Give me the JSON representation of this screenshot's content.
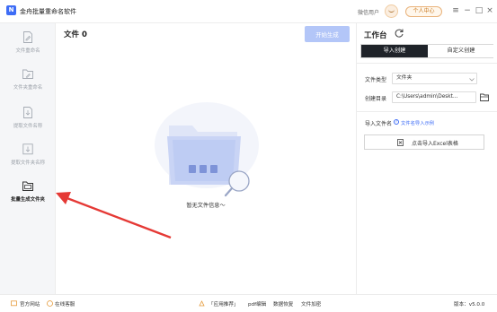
{
  "titlebar": {
    "app_title": "金舟批量重命名软件",
    "user_label": "微信用户",
    "vip_button": "个人中心",
    "menu_icon": "≡",
    "minimize_icon": "−",
    "maximize_icon": "□",
    "close_icon": "×"
  },
  "sidebar": {
    "items": [
      {
        "label": "文件重命名",
        "icon": "file-rename-icon"
      },
      {
        "label": "文件夹重命名",
        "icon": "folder-rename-icon"
      },
      {
        "label": "提取文件名称",
        "icon": "extract-file-icon"
      },
      {
        "label": "提取文件夹名称",
        "icon": "extract-folder-icon"
      },
      {
        "label": "批量生成文件夹",
        "icon": "batch-folder-icon",
        "active": true
      }
    ]
  },
  "main": {
    "file_count_title": "文件 0",
    "start_button": "开始生成",
    "empty_text": "暂无文件信息～"
  },
  "panel": {
    "title": "工作台",
    "tabs": [
      {
        "label": "导入创建",
        "active": true
      },
      {
        "label": "自定义创建",
        "active": false
      }
    ],
    "file_type_label": "文件类型",
    "file_type_value": "文件夹",
    "create_dir_label": "创建目录",
    "create_dir_value": "C:\\Users\\admin\\Deskt...",
    "import_names_label": "导入文件名",
    "help_link": "文件名导入示例",
    "import_button": "点击导入Excel表格"
  },
  "bottombar": {
    "official_site": "官方网站",
    "online_support": "在线客服",
    "app_recommend": "「应用推荐」",
    "pdf_edit": "pdf编辑",
    "data_recovery": "数据恢复",
    "file_encrypt": "文件加密",
    "version": "版本：v5.0.0"
  },
  "colors": {
    "accent": "#3e6df6",
    "start_button_disabled": "#b3c6f8",
    "active_tab": "#1f2329",
    "sidebar_bg": "#f5f6f8",
    "vip_orange": "#e9b27a",
    "arrow_red": "#e53935"
  }
}
